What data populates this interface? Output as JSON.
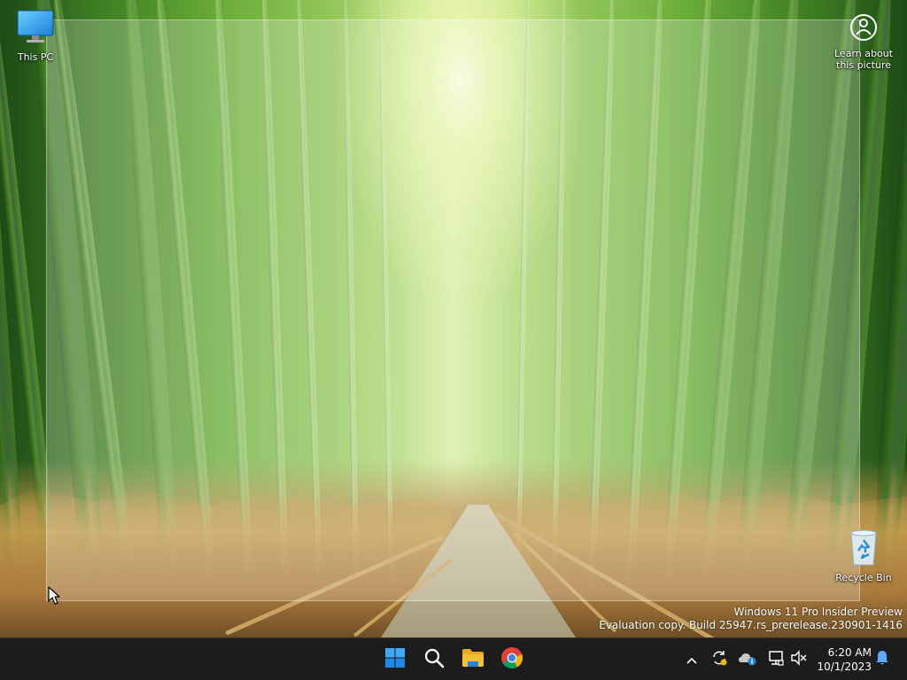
{
  "desktop": {
    "icons": [
      {
        "label": "This PC",
        "icon": "computer-monitor-icon"
      },
      {
        "label": "Learn about this picture",
        "icon": "camera-aperture-icon"
      },
      {
        "label": "Recycle Bin",
        "icon": "recycle-bin-icon"
      }
    ],
    "watermark": {
      "line1": "Windows 11 Pro Insider Preview",
      "line2": "Evaluation copy. Build 25947.rs_prerelease.230901-1416"
    }
  },
  "taskbar": {
    "pinned": [
      {
        "name": "Start",
        "icon": "windows-logo-icon"
      },
      {
        "name": "Search",
        "icon": "search-icon"
      },
      {
        "name": "File Explorer",
        "icon": "folder-icon"
      },
      {
        "name": "Google Chrome",
        "icon": "chrome-icon"
      }
    ],
    "tray": [
      {
        "icon": "chevron-up-icon"
      },
      {
        "icon": "sync-icon"
      },
      {
        "icon": "onedrive-cloud-icon"
      },
      {
        "icon": "network-icon"
      },
      {
        "icon": "volume-muted-icon"
      }
    ],
    "clock": {
      "time": "6:20 AM",
      "date": "10/1/2023"
    },
    "notifications_icon": "bell-icon"
  },
  "colors": {
    "taskbar_bg": "#1c1c1c",
    "windows_blue": "#0078d4",
    "folder_yellow": "#f4c033"
  }
}
